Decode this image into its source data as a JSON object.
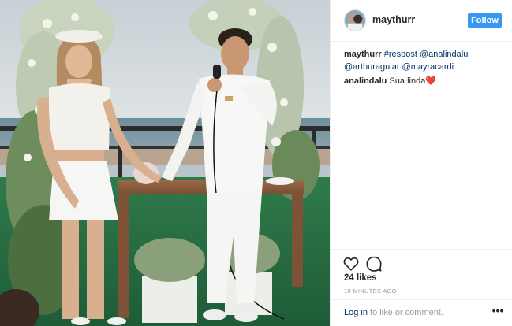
{
  "post": {
    "username": "maythurr",
    "follow_label": "Follow",
    "caption": {
      "user": "maythurr",
      "text_parts": [
        "#respost",
        "@analindalu",
        "@arthuraguiar",
        "@mayracardi"
      ]
    },
    "comment": {
      "user": "analindalu",
      "text": "Sua linda",
      "emoji": "❤️"
    },
    "likes_label": "24 likes",
    "timestamp": "18 MINUTES AGO",
    "login_link": "Log in",
    "login_suffix": "to like or comment.",
    "more_symbol": "•••"
  },
  "icons": {
    "like": "heart-outline-icon",
    "comment": "speech-bubble-icon",
    "more": "ellipsis-icon"
  },
  "colors": {
    "follow_blue": "#3897f0",
    "link_dark_blue": "#003569",
    "muted_gray": "#999999",
    "border": "#efefef"
  }
}
